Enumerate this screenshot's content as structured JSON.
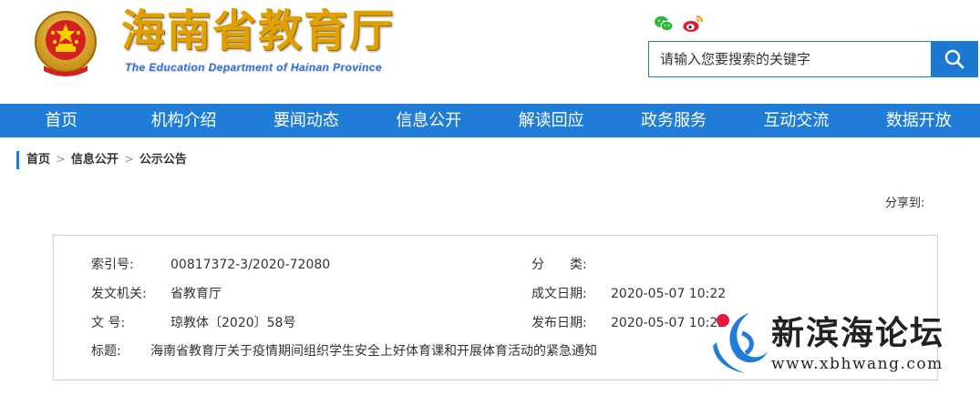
{
  "header": {
    "title": "海南省教育厅",
    "subtitle": "The Education Department of Hainan Province",
    "social": {
      "wechat_icon": "wechat-icon",
      "weibo_icon": "weibo-icon"
    },
    "search": {
      "placeholder": "请输入您要搜索的关键字",
      "icon": "search-icon"
    }
  },
  "nav": {
    "items": [
      {
        "label": "首页"
      },
      {
        "label": "机构介绍"
      },
      {
        "label": "要闻动态"
      },
      {
        "label": "信息公开"
      },
      {
        "label": "解读回应"
      },
      {
        "label": "政务服务"
      },
      {
        "label": "互动交流"
      },
      {
        "label": "数据开放"
      }
    ]
  },
  "breadcrumb": {
    "items": [
      "首页",
      "信息公开",
      "公示公告"
    ],
    "separator": ">"
  },
  "share_label": "分享到:",
  "info": {
    "index_label": "索引号:",
    "index_value": "00817372-3/2020-72080",
    "category_label": "分　　类:",
    "category_value": "",
    "issuer_label": "发文机关:",
    "issuer_value": "省教育厅",
    "written_date_label": "成文日期:",
    "written_date_value": "2020-05-07 10:22",
    "doc_no_label": "文 号:",
    "doc_no_value": "琼教体〔2020〕58号",
    "publish_date_label": "发布日期:",
    "publish_date_value": "2020-05-07 10:22",
    "title_label": "标题:",
    "title_value": "海南省教育厅关于疫情期间组织学生安全上好体育课和开展体育活动的紧急通知"
  },
  "watermark": {
    "name": "新滨海论坛",
    "url": "www.xbhwang.com"
  },
  "colors": {
    "primary_blue": "#1f7dd8",
    "title_gold": "#e0a000",
    "subtitle_blue": "#3b6fc9",
    "border_gray": "#cfcfcf"
  }
}
